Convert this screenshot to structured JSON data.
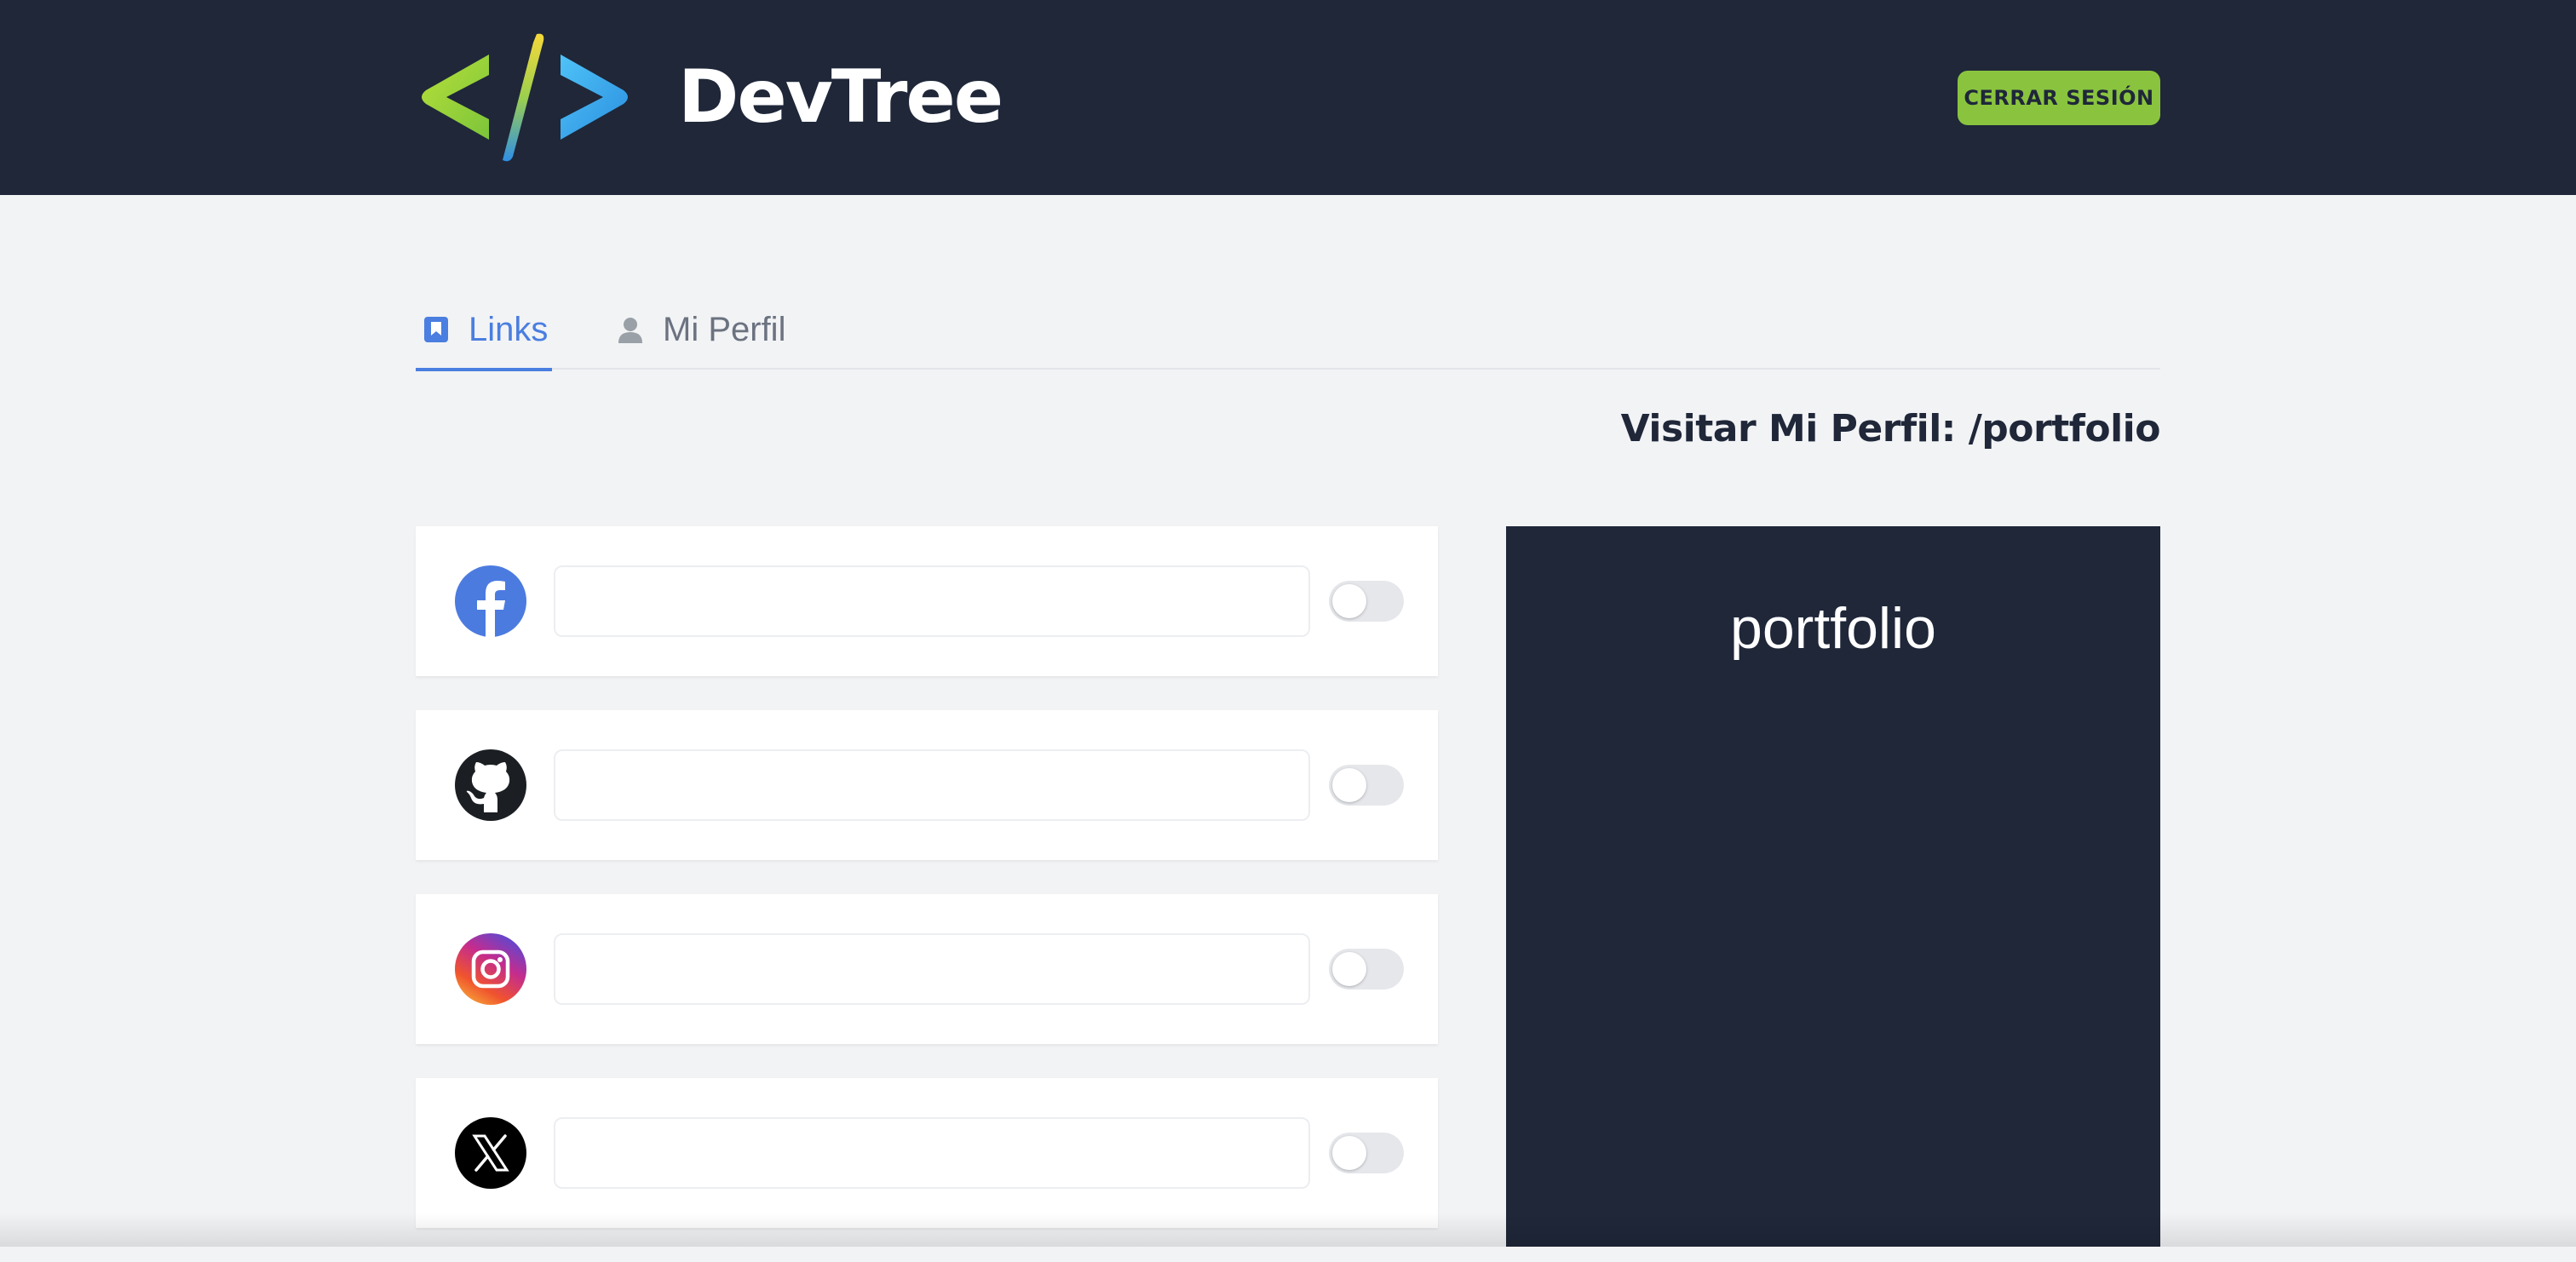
{
  "header": {
    "brand": "DevTree",
    "logout_label": "CERRAR SESIÓN"
  },
  "tabs": [
    {
      "label": "Links",
      "icon": "bookmark-icon",
      "active": true
    },
    {
      "label": "Mi Perfil",
      "icon": "user-icon",
      "active": false
    }
  ],
  "visit_profile": "Visitar Mi Perfil: /portfolio",
  "links": [
    {
      "icon": "facebook-icon",
      "url": "",
      "enabled": false
    },
    {
      "icon": "github-icon",
      "url": "",
      "enabled": false
    },
    {
      "icon": "instagram-icon",
      "url": "",
      "enabled": false
    },
    {
      "icon": "x-icon",
      "url": "",
      "enabled": false
    }
  ],
  "preview": {
    "handle": "portfolio"
  },
  "colors": {
    "header_bg": "#1f2739",
    "accent_green": "#8ac43f",
    "active_tab": "#4a7ee0",
    "page_bg": "#f2f3f5"
  }
}
